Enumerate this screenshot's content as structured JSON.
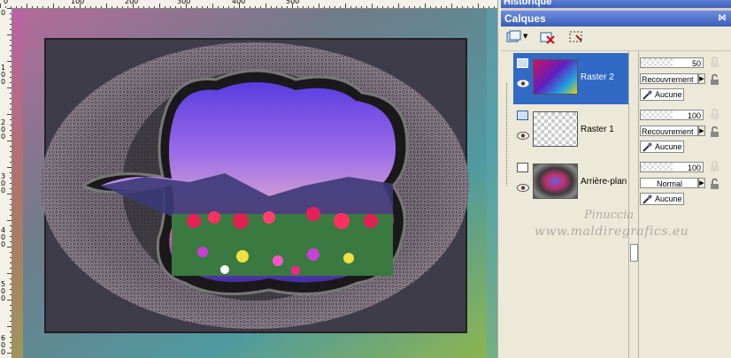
{
  "top_panel": {
    "title": "Historique"
  },
  "layers_panel": {
    "title": "Calques",
    "layers": [
      {
        "name": "Raster 2",
        "opacity": "50",
        "blend_mode": "Recouvrement",
        "mask": "Aucune",
        "selected": true
      },
      {
        "name": "Raster 1",
        "opacity": "100",
        "blend_mode": "Recouvrement",
        "mask": "Aucune",
        "selected": false
      },
      {
        "name": "Arrière-plan",
        "opacity": "100",
        "blend_mode": "Normal",
        "mask": "Aucune",
        "selected": false
      }
    ]
  },
  "ruler_top": [
    "0",
    "100",
    "200",
    "300",
    "400",
    "500"
  ],
  "ruler_left": [
    "0",
    "1\n0\n0",
    "2\n0\n0",
    "3\n0\n0",
    "4\n0\n0",
    "5\n0\n0",
    "6\n0\n0"
  ],
  "watermark": {
    "line1": "Pinuccia",
    "line2": "www.maldiregrafics.eu"
  },
  "colors": {
    "selection": "#316ac5",
    "panel_bg": "#ece9d8",
    "title_bar": "#3f62b8"
  }
}
